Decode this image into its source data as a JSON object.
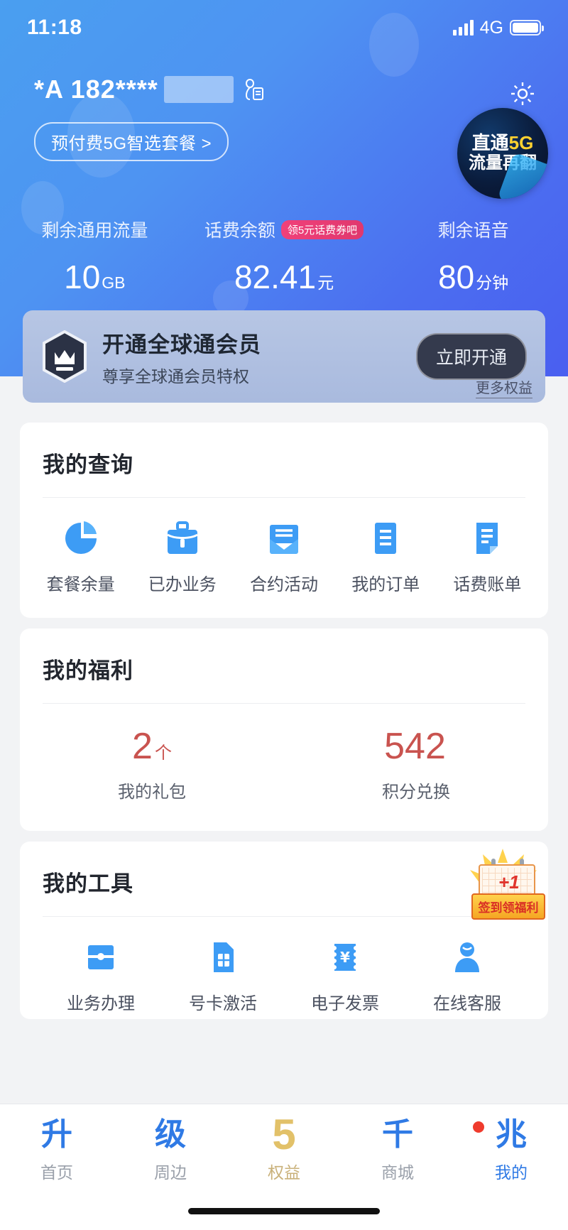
{
  "status_bar": {
    "time": "11:18",
    "network": "4G",
    "signal_icon": "signal-bars-icon",
    "battery_icon": "battery-full-icon"
  },
  "header": {
    "account_name": "*A 182****",
    "account_masked": "",
    "id_card_icon": "id-card-icon",
    "settings_icon": "gear-icon",
    "plan_label": "预付费5G智选套餐 >",
    "promo": {
      "line1_prefix": "直通",
      "line1_highlight": "5G",
      "line2": "流量再翻"
    }
  },
  "stats": [
    {
      "label": "剩余通用流量",
      "value": "10",
      "unit": "GB",
      "badge": ""
    },
    {
      "label": "话费余额",
      "value": "82.41",
      "unit": "元",
      "badge": "领5元话费券吧"
    },
    {
      "label": "剩余语音",
      "value": "80",
      "unit": "分钟",
      "badge": ""
    }
  ],
  "membership": {
    "icon": "crown-badge-icon",
    "title": "开通全球通会员",
    "subtitle": "尊享全球通会员特权",
    "button": "立即开通",
    "more_link": "更多权益"
  },
  "query_section": {
    "title": "我的查询",
    "items": [
      {
        "label": "套餐余量",
        "icon": "pie-chart-icon"
      },
      {
        "label": "已办业务",
        "icon": "briefcase-icon"
      },
      {
        "label": "合约活动",
        "icon": "envelope-icon"
      },
      {
        "label": "我的订单",
        "icon": "list-document-icon"
      },
      {
        "label": "话费账单",
        "icon": "bill-document-icon"
      }
    ]
  },
  "welfare_section": {
    "title": "我的福利",
    "items": [
      {
        "value": "2",
        "unit": "个",
        "label": "我的礼包"
      },
      {
        "value": "542",
        "unit": "",
        "label": "积分兑换"
      }
    ]
  },
  "tools_section": {
    "title": "我的工具",
    "sticker_label": "签到领福利",
    "sticker_plus": "+1",
    "items": [
      {
        "label": "业务办理",
        "icon": "service-card-icon"
      },
      {
        "label": "号卡激活",
        "icon": "sim-card-icon"
      },
      {
        "label": "电子发票",
        "icon": "invoice-yuan-icon"
      },
      {
        "label": "在线客服",
        "icon": "person-support-icon"
      }
    ]
  },
  "tab_bar": {
    "items": [
      {
        "label": "首页",
        "glyph": "升",
        "icon": "home-tab-icon",
        "active": false
      },
      {
        "label": "周边",
        "glyph": "级",
        "icon": "nearby-tab-icon",
        "active": false
      },
      {
        "label": "权益",
        "glyph": "5",
        "icon": "benefits-tab-icon",
        "active": false
      },
      {
        "label": "商城",
        "glyph": "千",
        "icon": "store-tab-icon",
        "active": false
      },
      {
        "label": "我的",
        "glyph": "兆",
        "icon": "profile-tab-icon",
        "active": true
      }
    ],
    "badge_dot": "notification-dot"
  },
  "colors": {
    "hero_gradient_start": "#4a9ff0",
    "hero_gradient_end": "#4a5ff0",
    "accent_blue": "#2f7ae5",
    "icon_blue": "#3d9cf5",
    "welfare_red": "#c9534f",
    "coupon_pink": "#f0407a",
    "tab_gold": "#e2c169"
  }
}
